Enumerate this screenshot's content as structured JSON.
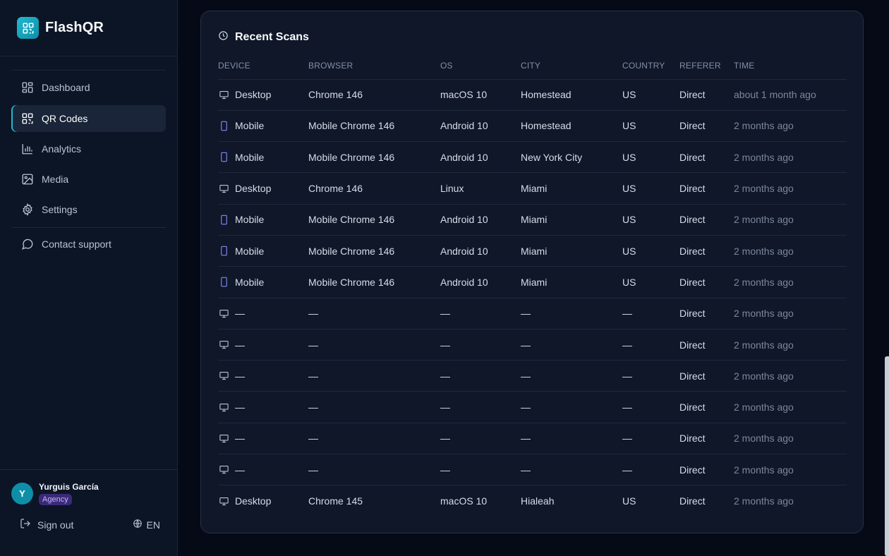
{
  "brand": {
    "name": "FlashQR",
    "accent": "#22b8cf"
  },
  "nav": {
    "items": [
      {
        "key": "dashboard",
        "label": "Dashboard",
        "icon": "dashboard-icon",
        "active": false
      },
      {
        "key": "qr-codes",
        "label": "QR Codes",
        "icon": "qr-code-icon",
        "active": true
      },
      {
        "key": "analytics",
        "label": "Analytics",
        "icon": "bar-chart-icon",
        "active": false
      },
      {
        "key": "media",
        "label": "Media",
        "icon": "image-icon",
        "active": false
      },
      {
        "key": "settings",
        "label": "Settings",
        "icon": "gear-icon",
        "active": false
      }
    ],
    "support": {
      "label": "Contact support",
      "icon": "chat-bubble-icon"
    }
  },
  "user": {
    "initial": "Y",
    "name": "Yurguis García",
    "badge": "Agency",
    "badge_color": "#3b2a78"
  },
  "footer": {
    "signout_label": "Sign out",
    "language": "EN"
  },
  "scans": {
    "title": "Recent Scans",
    "columns": [
      "DEVICE",
      "BROWSER",
      "OS",
      "CITY",
      "COUNTRY",
      "REFERER",
      "TIME"
    ],
    "rows": [
      {
        "device_type": "desktop",
        "device": "Desktop",
        "browser": "Chrome 146",
        "os": "macOS 10",
        "city": "Homestead",
        "country": "US",
        "referer": "Direct",
        "time": "about 1 month ago"
      },
      {
        "device_type": "mobile",
        "device": "Mobile",
        "browser": "Mobile Chrome 146",
        "os": "Android 10",
        "city": "Homestead",
        "country": "US",
        "referer": "Direct",
        "time": "2 months ago"
      },
      {
        "device_type": "mobile",
        "device": "Mobile",
        "browser": "Mobile Chrome 146",
        "os": "Android 10",
        "city": "New York City",
        "country": "US",
        "referer": "Direct",
        "time": "2 months ago"
      },
      {
        "device_type": "desktop",
        "device": "Desktop",
        "browser": "Chrome 146",
        "os": "Linux",
        "city": "Miami",
        "country": "US",
        "referer": "Direct",
        "time": "2 months ago"
      },
      {
        "device_type": "mobile",
        "device": "Mobile",
        "browser": "Mobile Chrome 146",
        "os": "Android 10",
        "city": "Miami",
        "country": "US",
        "referer": "Direct",
        "time": "2 months ago"
      },
      {
        "device_type": "mobile",
        "device": "Mobile",
        "browser": "Mobile Chrome 146",
        "os": "Android 10",
        "city": "Miami",
        "country": "US",
        "referer": "Direct",
        "time": "2 months ago"
      },
      {
        "device_type": "mobile",
        "device": "Mobile",
        "browser": "Mobile Chrome 146",
        "os": "Android 10",
        "city": "Miami",
        "country": "US",
        "referer": "Direct",
        "time": "2 months ago"
      },
      {
        "device_type": "desktop",
        "device": "—",
        "browser": "—",
        "os": "—",
        "city": "—",
        "country": "—",
        "referer": "Direct",
        "time": "2 months ago"
      },
      {
        "device_type": "desktop",
        "device": "—",
        "browser": "—",
        "os": "—",
        "city": "—",
        "country": "—",
        "referer": "Direct",
        "time": "2 months ago"
      },
      {
        "device_type": "desktop",
        "device": "—",
        "browser": "—",
        "os": "—",
        "city": "—",
        "country": "—",
        "referer": "Direct",
        "time": "2 months ago"
      },
      {
        "device_type": "desktop",
        "device": "—",
        "browser": "—",
        "os": "—",
        "city": "—",
        "country": "—",
        "referer": "Direct",
        "time": "2 months ago"
      },
      {
        "device_type": "desktop",
        "device": "—",
        "browser": "—",
        "os": "—",
        "city": "—",
        "country": "—",
        "referer": "Direct",
        "time": "2 months ago"
      },
      {
        "device_type": "desktop",
        "device": "—",
        "browser": "—",
        "os": "—",
        "city": "—",
        "country": "—",
        "referer": "Direct",
        "time": "2 months ago"
      },
      {
        "device_type": "desktop",
        "device": "Desktop",
        "browser": "Chrome 145",
        "os": "macOS 10",
        "city": "Hialeah",
        "country": "US",
        "referer": "Direct",
        "time": "2 months ago"
      }
    ]
  }
}
